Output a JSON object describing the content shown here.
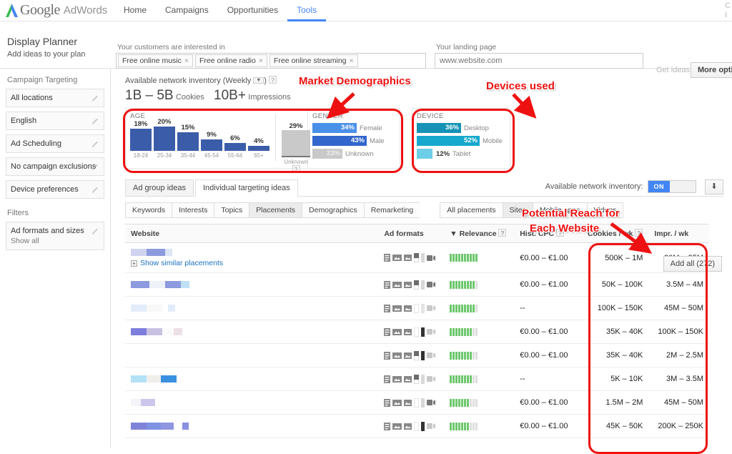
{
  "topbar": {
    "logo_text": "Google",
    "logo_sub": "AdWords",
    "nav": [
      {
        "label": "Home",
        "active": false
      },
      {
        "label": "Campaigns",
        "active": false
      },
      {
        "label": "Opportunities",
        "active": false
      },
      {
        "label": "Tools",
        "active": true
      }
    ],
    "corner_text_1": "C",
    "corner_text_2": "I"
  },
  "header": {
    "title": "Display Planner",
    "subtitle": "Add ideas to your plan",
    "interests_label": "Your customers are interested in",
    "chips": [
      "Free online music",
      "Free online radio",
      "Free online streaming"
    ],
    "chip_close": "×",
    "landing_label": "Your landing page",
    "landing_value": "",
    "landing_placeholder": "www.website.com",
    "get_ideas_label": "Get ideas",
    "more_options_label": "More options"
  },
  "sidebar": {
    "targeting_header": "Campaign Targeting",
    "targeting_items": [
      {
        "label": "All locations"
      },
      {
        "label": "English"
      },
      {
        "label": "Ad Scheduling"
      },
      {
        "label": "No campaign exclusions"
      },
      {
        "label": "Device preferences"
      }
    ],
    "filters_header": "Filters",
    "filter_items": [
      {
        "label": "Ad formats and sizes",
        "sub": "Show all"
      }
    ]
  },
  "inventory": {
    "line_label": "Available network inventory (Weekly",
    "line_suffix": ")",
    "period": "Weekly",
    "help": "?",
    "cookies_value": "1B – 5B",
    "cookies_unit": "Cookies",
    "impressions_value": "10B+",
    "impressions_unit": "Impressions",
    "toggle_label": "Available network inventory:",
    "toggle_on": "ON",
    "download_icon": "download-icon"
  },
  "chart_data": [
    {
      "type": "bar",
      "title": "AGE",
      "categories": [
        "18-24",
        "25-34",
        "35-44",
        "45-54",
        "55-64",
        "65+"
      ],
      "values": [
        18,
        20,
        15,
        9,
        6,
        4
      ],
      "value_labels": [
        "18%",
        "20%",
        "15%",
        "9%",
        "6%",
        "4%"
      ],
      "unknown_label": "Unknown",
      "unknown_value": 29,
      "unknown_value_label": "29%",
      "ylim": [
        0,
        30
      ],
      "bar_color": "#3b5ca8",
      "unknown_color": "#c9c9c9",
      "xlabel": "",
      "ylabel": ""
    },
    {
      "type": "bar",
      "title": "GENDER",
      "categories": [
        "Female",
        "Male",
        "Unknown"
      ],
      "values": [
        34,
        43,
        23
      ],
      "value_labels": [
        "34%",
        "43%",
        "23%"
      ],
      "colors": [
        "#4a90e8",
        "#3366cc",
        "#c9c9c9"
      ],
      "xlabel": "",
      "ylabel": ""
    },
    {
      "type": "bar",
      "title": "DEVICE",
      "categories": [
        "Desktop",
        "Mobile",
        "Tablet"
      ],
      "values": [
        36,
        52,
        12
      ],
      "value_labels": [
        "36%",
        "52%",
        "12%"
      ],
      "colors": [
        "#1592b5",
        "#17a8ce",
        "#6dcee8"
      ],
      "xlabel": "",
      "ylabel": ""
    }
  ],
  "tabs": {
    "main": [
      {
        "label": "Ad group ideas",
        "active": false
      },
      {
        "label": "Individual targeting ideas",
        "active": true
      }
    ],
    "sub_left": [
      {
        "label": "Keywords",
        "active": false
      },
      {
        "label": "Interests",
        "active": false
      },
      {
        "label": "Topics",
        "active": false
      },
      {
        "label": "Placements",
        "active": true
      },
      {
        "label": "Demographics",
        "active": false
      },
      {
        "label": "Remarketing",
        "active": false
      }
    ],
    "sub_right": [
      {
        "label": "All placements",
        "active": false
      },
      {
        "label": "Sites",
        "active": true
      },
      {
        "label": "Mobile apps",
        "active": false
      },
      {
        "label": "Videos",
        "active": false
      }
    ],
    "add_all_label": "Add all (272)"
  },
  "table": {
    "columns": [
      "Website",
      "Ad formats",
      "Relevance",
      "Hist. CPC",
      "Cookies / wk",
      "Impr. / wk"
    ],
    "sort_indicator": "▼",
    "help": "?",
    "show_similar_label": "Show similar placements",
    "rows": [
      {
        "website_redacted": true,
        "formats": 6,
        "relevance": 10,
        "cpc": "€0.00 – €1.00",
        "cookies": "500K – 1M",
        "impr": "30M – 35M",
        "has_show_similar": true
      },
      {
        "website_redacted": true,
        "formats": 6,
        "relevance": 9,
        "cpc": "€0.00 – €1.00",
        "cookies": "50K – 100K",
        "impr": "3.5M – 4M",
        "has_show_similar": false
      },
      {
        "website_redacted": true,
        "formats": 6,
        "relevance": 9,
        "cpc": "--",
        "cookies": "100K – 150K",
        "impr": "45M – 50M",
        "has_show_similar": false
      },
      {
        "website_redacted": true,
        "formats": 6,
        "relevance": 8,
        "cpc": "€0.00 – €1.00",
        "cookies": "35K – 40K",
        "impr": "100K – 150K",
        "has_show_similar": false
      },
      {
        "website_redacted": true,
        "formats": 6,
        "relevance": 8,
        "cpc": "€0.00 – €1.00",
        "cookies": "35K – 40K",
        "impr": "2M – 2.5M",
        "has_show_similar": false
      },
      {
        "website_redacted": true,
        "formats": 6,
        "relevance": 8,
        "cpc": "--",
        "cookies": "5K – 10K",
        "impr": "3M – 3.5M",
        "has_show_similar": false
      },
      {
        "website_redacted": true,
        "formats": 6,
        "relevance": 7,
        "cpc": "€0.00 – €1.00",
        "cookies": "1.5M – 2M",
        "impr": "45M – 50M",
        "has_show_similar": false
      },
      {
        "website_redacted": true,
        "formats": 6,
        "relevance": 7,
        "cpc": "€0.00 – €1.00",
        "cookies": "45K – 50K",
        "impr": "200K – 250K",
        "has_show_similar": false
      }
    ]
  },
  "annotations": [
    {
      "text": "Market Demographics",
      "id": "market-demographics"
    },
    {
      "text": "Devices used",
      "id": "devices-used"
    },
    {
      "text": "Potential Reach for",
      "id": "potential-reach-1"
    },
    {
      "text": "Each Website",
      "id": "potential-reach-2"
    }
  ],
  "colors": {
    "accent": "#4285f4",
    "annotation": "#ee1111",
    "relevance": "#6dc76d",
    "age_bar": "#3b5ca8"
  }
}
